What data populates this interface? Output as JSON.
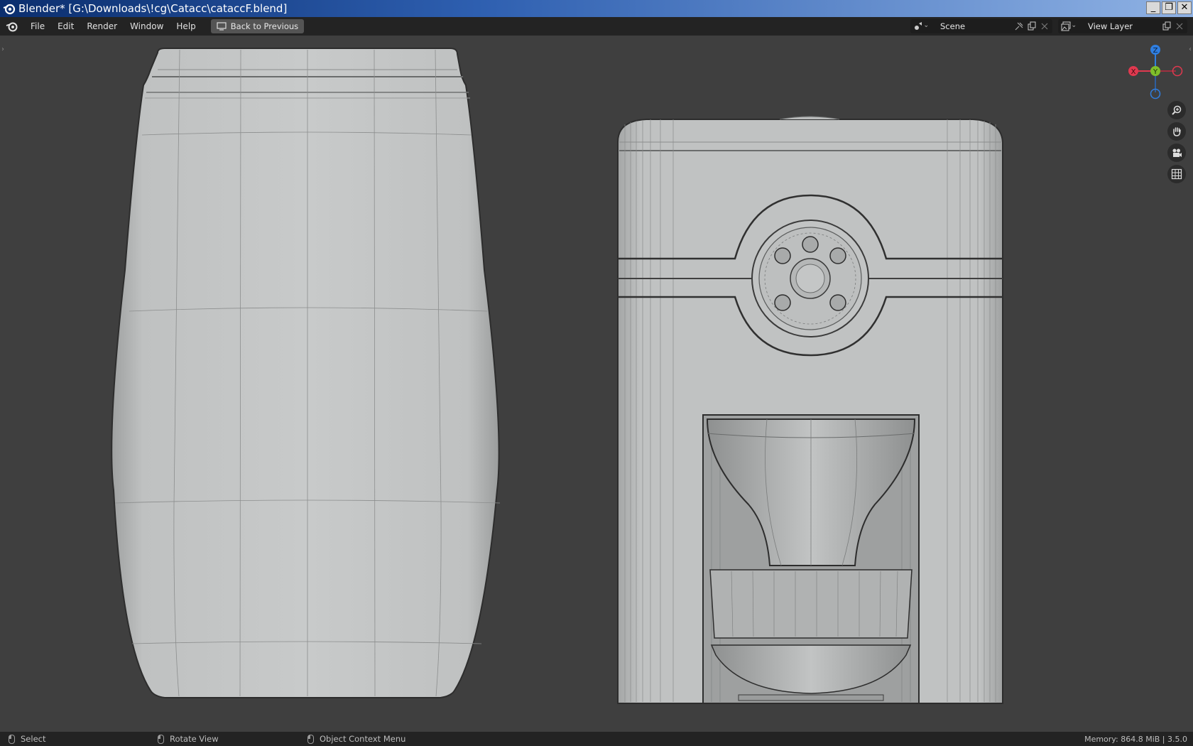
{
  "window": {
    "title": "Blender* [G:\\Downloads\\!cg\\Catacc\\cataccF.blend]",
    "controls": [
      "_",
      "❐",
      "✕"
    ]
  },
  "menubar": {
    "items": [
      "File",
      "Edit",
      "Render",
      "Window",
      "Help"
    ],
    "back_button": "Back to Previous",
    "scene_field": "Scene",
    "view_layer_field": "View Layer"
  },
  "viewport": {
    "gizmo": {
      "z": "Z",
      "y": "Y",
      "x": "X"
    },
    "gizmo_colors": {
      "z": "#2f7ee0",
      "y": "#7fbf2a",
      "x": "#e0394f"
    },
    "nav_buttons": [
      "zoom-icon",
      "pan-hand-icon",
      "camera-icon",
      "grid-icon"
    ],
    "background": "#3f3f3f",
    "model_color": "#c4c6c6"
  },
  "statusbar": {
    "select": "Select",
    "rotate": "Rotate View",
    "context": "Object Context Menu",
    "memory": "Memory: 864.8 MiB | 3.5.0"
  }
}
